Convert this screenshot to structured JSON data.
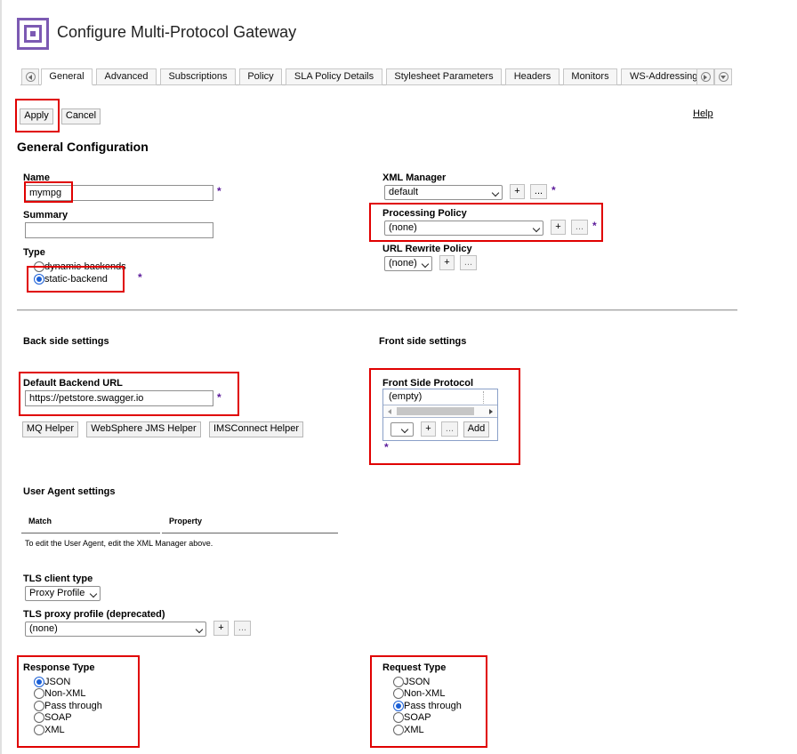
{
  "page": {
    "title": "Configure Multi-Protocol Gateway"
  },
  "tabs": [
    "General",
    "Advanced",
    "Subscriptions",
    "Policy",
    "SLA Policy Details",
    "Stylesheet Parameters",
    "Headers",
    "Monitors",
    "WS-Addressing"
  ],
  "toolbar": {
    "apply": "Apply",
    "cancel": "Cancel",
    "help": "Help"
  },
  "section_title": "General Configuration",
  "required_mark": "*",
  "name": {
    "label": "Name",
    "value": "mympg"
  },
  "summary": {
    "label": "Summary",
    "value": ""
  },
  "type": {
    "label": "Type",
    "options": [
      "dynamic-backends",
      "static-backend"
    ],
    "selected": "static-backend"
  },
  "xml_manager": {
    "label": "XML Manager",
    "value": "default"
  },
  "processing_policy": {
    "label": "Processing Policy",
    "value": "(none)"
  },
  "url_rewrite_policy": {
    "label": "URL Rewrite Policy",
    "value": "(none)"
  },
  "buttons": {
    "plus": "+",
    "dots": "..."
  },
  "back_side": {
    "heading": "Back side settings",
    "url_label": "Default Backend URL",
    "url_value": "https://petstore.swagger.io"
  },
  "helpers": [
    "MQ Helper",
    "WebSphere JMS Helper",
    "IMSConnect Helper"
  ],
  "front_side": {
    "heading": "Front side settings",
    "protocol_label": "Front Side Protocol",
    "list_value": "(empty)",
    "add": "Add"
  },
  "user_agent": {
    "heading": "User Agent settings",
    "columns": [
      "Match",
      "Property"
    ],
    "note": "To edit the User Agent, edit the XML Manager above."
  },
  "tls": {
    "client_label": "TLS client type",
    "client_value": "Proxy Profile",
    "proxy_label": "TLS proxy profile (deprecated)",
    "proxy_value": "(none)"
  },
  "response_type": {
    "label": "Response Type",
    "options": [
      "JSON",
      "Non-XML",
      "Pass through",
      "SOAP",
      "XML"
    ],
    "selected": "JSON"
  },
  "request_type": {
    "label": "Request Type",
    "options": [
      "JSON",
      "Non-XML",
      "Pass through",
      "SOAP",
      "XML"
    ],
    "selected": "Pass through"
  },
  "colors": {
    "highlight": "#e00000",
    "required": "#5b1a9a",
    "logo": "#7c5ab3",
    "radio": "#1a5fd6"
  }
}
